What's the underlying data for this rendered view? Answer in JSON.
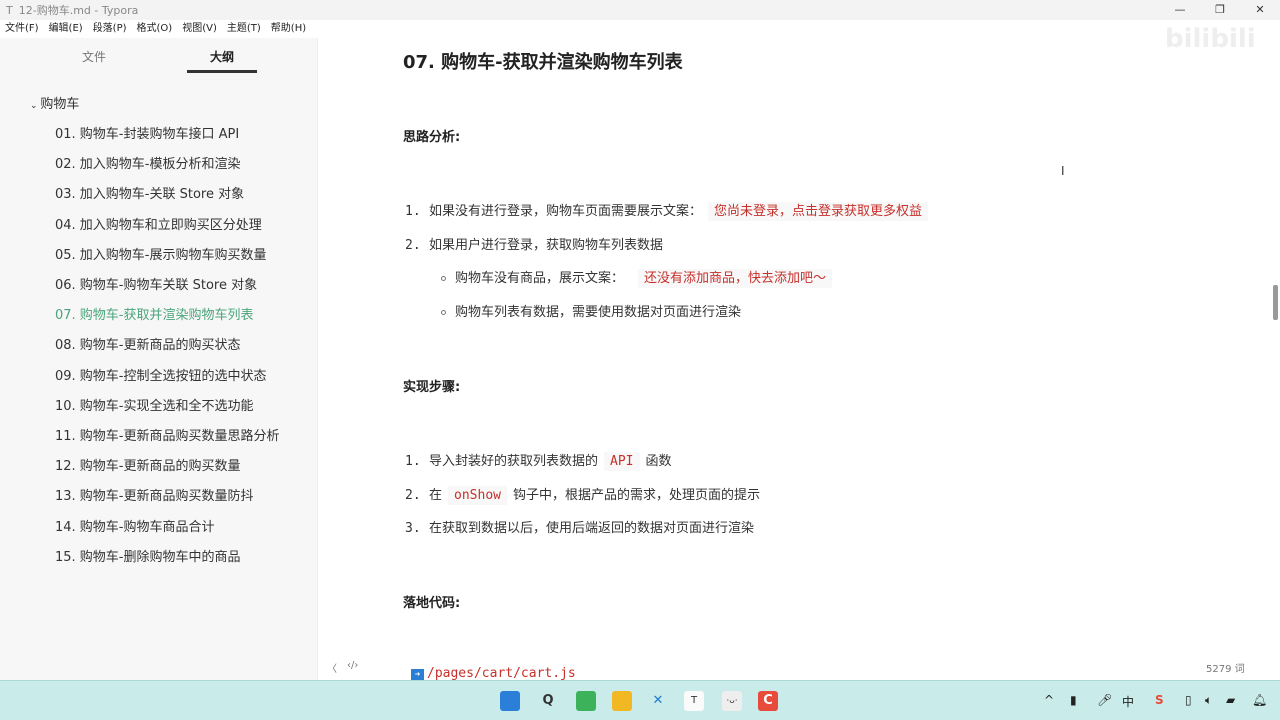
{
  "window": {
    "title": "12-购物车.md - Typora",
    "app_icon": "T"
  },
  "menu": [
    "文件(F)",
    "编辑(E)",
    "段落(P)",
    "格式(O)",
    "视图(V)",
    "主题(T)",
    "帮助(H)"
  ],
  "sidebar": {
    "tabs": [
      "文件",
      "大纲"
    ],
    "active_tab": "大纲",
    "root": "购物车",
    "items": [
      "01. 购物车-封装购物车接口 API",
      "02. 加入购物车-模板分析和渲染",
      "03. 加入购物车-关联 Store 对象",
      "04. 加入购物车和立即购买区分处理",
      "05. 加入购物车-展示购物车购买数量",
      "06. 购物车-购物车关联 Store 对象",
      "07. 购物车-获取并渲染购物车列表",
      "08. 购物车-更新商品的购买状态",
      "09. 购物车-控制全选按钮的选中状态",
      "10. 购物车-实现全选和全不选功能",
      "11. 购物车-更新商品购买数量思路分析",
      "12. 购物车-更新商品的购买数量",
      "13. 购物车-更新商品购买数量防抖",
      "14. 购物车-购物车商品合计",
      "15. 购物车-删除购物车中的商品"
    ],
    "active_index": 6
  },
  "doc": {
    "title": "07. 购物车-获取并渲染购物车列表",
    "s1": "思路分析:",
    "l1": {
      "n": "1.",
      "t": "如果没有进行登录，购物车页面需要展示文案：",
      "c": "您尚未登录，点击登录获取更多权益"
    },
    "l2": {
      "n": "2.",
      "t": "如果用户进行登录，获取购物车列表数据"
    },
    "b1": {
      "t": "购物车没有商品，展示文案：",
      "c": "还没有添加商品，快去添加吧～"
    },
    "b2": {
      "t": "购物车列表有数据，需要使用数据对页面进行渲染"
    },
    "s2": "实现步骤:",
    "m1": {
      "n": "1.",
      "a": "导入封装好的获取列表数据的",
      "c": "API",
      "b": "函数"
    },
    "m2": {
      "n": "2.",
      "a": "在",
      "c": "onShow",
      "b": "钩子中，根据产品的需求，处理页面的提示"
    },
    "m3": {
      "n": "3.",
      "a": "在获取到数据以后，使用后端返回的数据对页面进行渲染"
    },
    "s3": "落地代码:",
    "file": "/pages/cart/cart.js"
  },
  "footer": {
    "word_count": "5279 词"
  },
  "colors": {
    "accent": "#4aa57a",
    "code": "#c7302b",
    "taskbar": "#c9ecea"
  }
}
